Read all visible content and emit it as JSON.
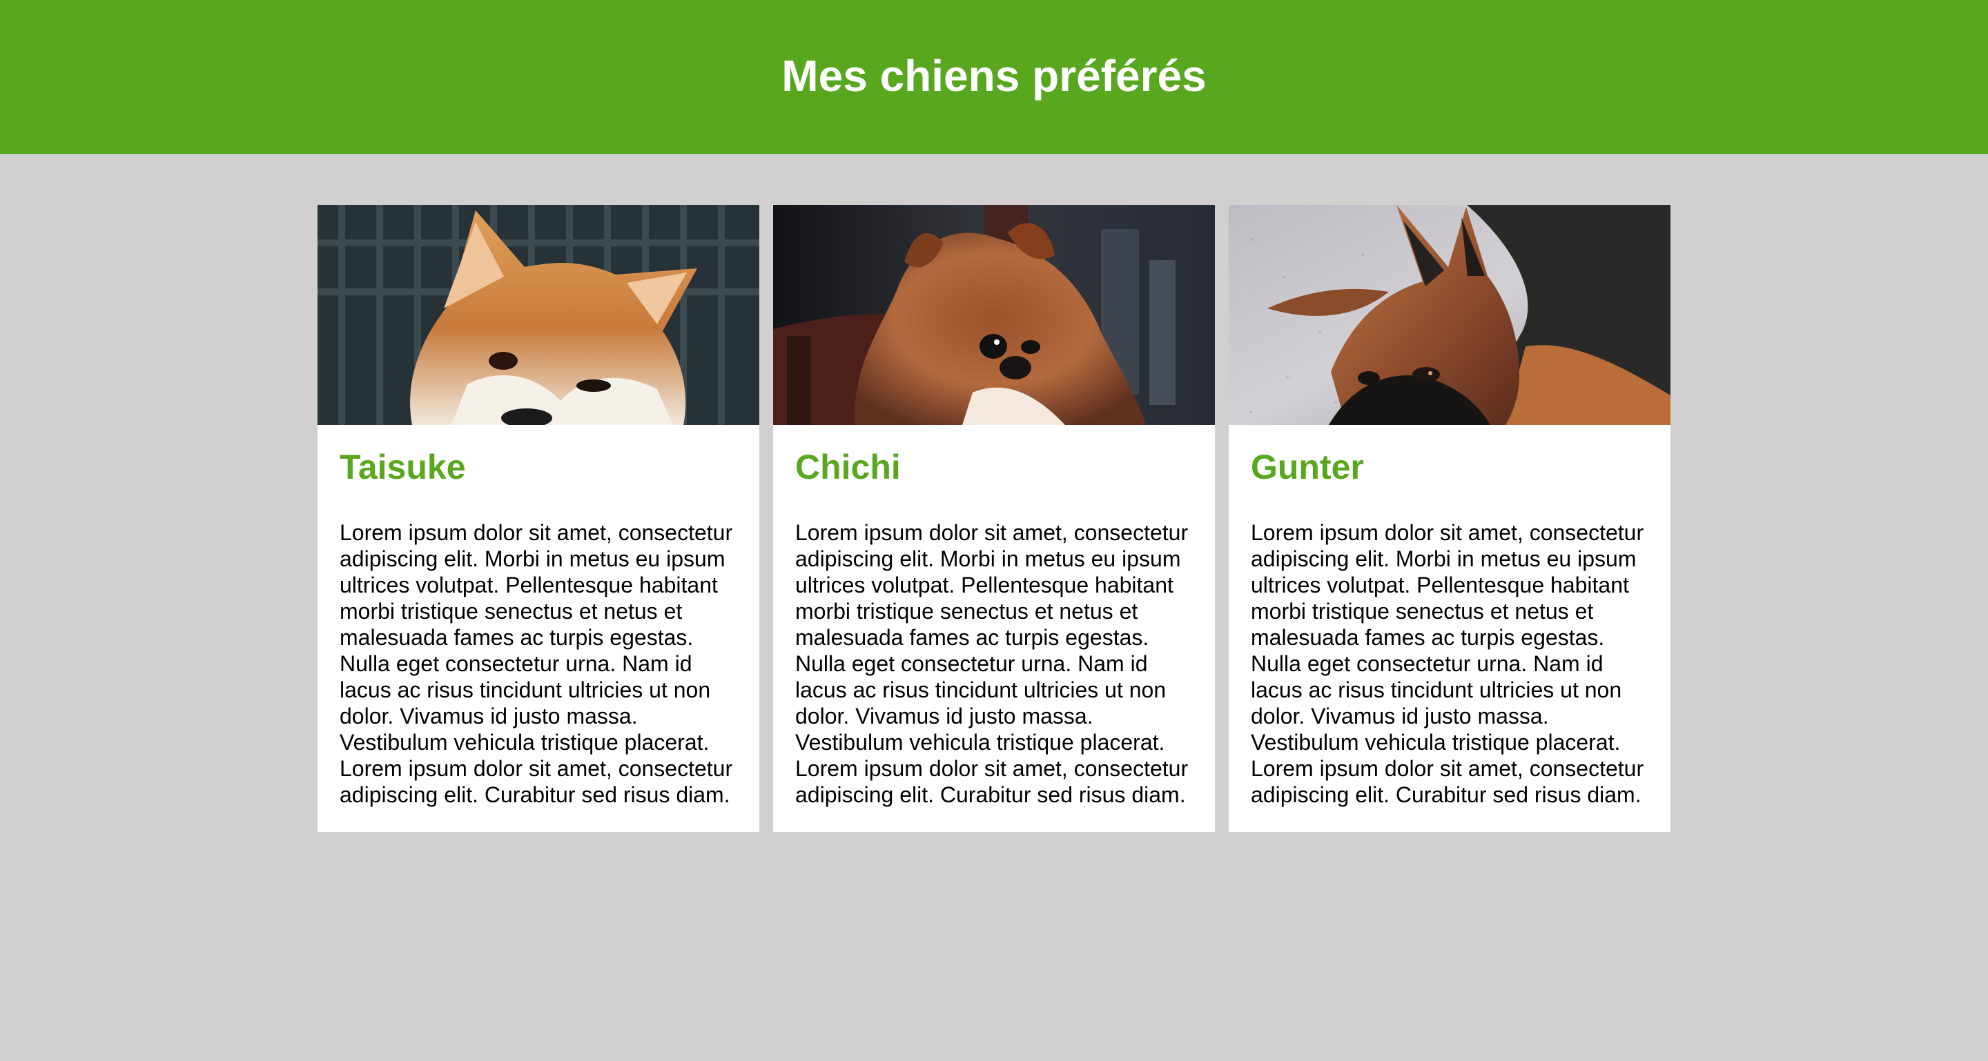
{
  "header": {
    "title": "Mes chiens préférés"
  },
  "colors": {
    "accent": "#59a71e",
    "page_bg": "#d1cfd0",
    "card_bg": "#ffffff",
    "text": "#000000"
  },
  "cards": [
    {
      "name": "Taisuke",
      "image_icon": "shiba-inu-photo",
      "text": "Lorem ipsum dolor sit amet, consectetur adipiscing elit. Morbi in metus eu ipsum ultrices volutpat. Pellentesque habitant morbi tristique senectus et netus et malesuada fames ac turpis egestas. Nulla eget consectetur urna. Nam id lacus ac risus tincidunt ultricies ut non dolor. Vivamus id justo massa. Vestibulum vehicula tristique placerat. Lorem ipsum dolor sit amet, consectetur adipiscing elit. Curabitur sed risus diam."
    },
    {
      "name": "Chichi",
      "image_icon": "pomeranian-photo",
      "text": "Lorem ipsum dolor sit amet, consectetur adipiscing elit. Morbi in metus eu ipsum ultrices volutpat. Pellentesque habitant morbi tristique senectus et netus et malesuada fames ac turpis egestas. Nulla eget consectetur urna. Nam id lacus ac risus tincidunt ultricies ut non dolor. Vivamus id justo massa. Vestibulum vehicula tristique placerat. Lorem ipsum dolor sit amet, consectetur adipiscing elit. Curabitur sed risus diam."
    },
    {
      "name": "Gunter",
      "image_icon": "german-shepherd-photo",
      "text": "Lorem ipsum dolor sit amet, consectetur adipiscing elit. Morbi in metus eu ipsum ultrices volutpat. Pellentesque habitant morbi tristique senectus et netus et malesuada fames ac turpis egestas. Nulla eget consectetur urna. Nam id lacus ac risus tincidunt ultricies ut non dolor. Vivamus id justo massa. Vestibulum vehicula tristique placerat. Lorem ipsum dolor sit amet, consectetur adipiscing elit. Curabitur sed risus diam."
    }
  ]
}
